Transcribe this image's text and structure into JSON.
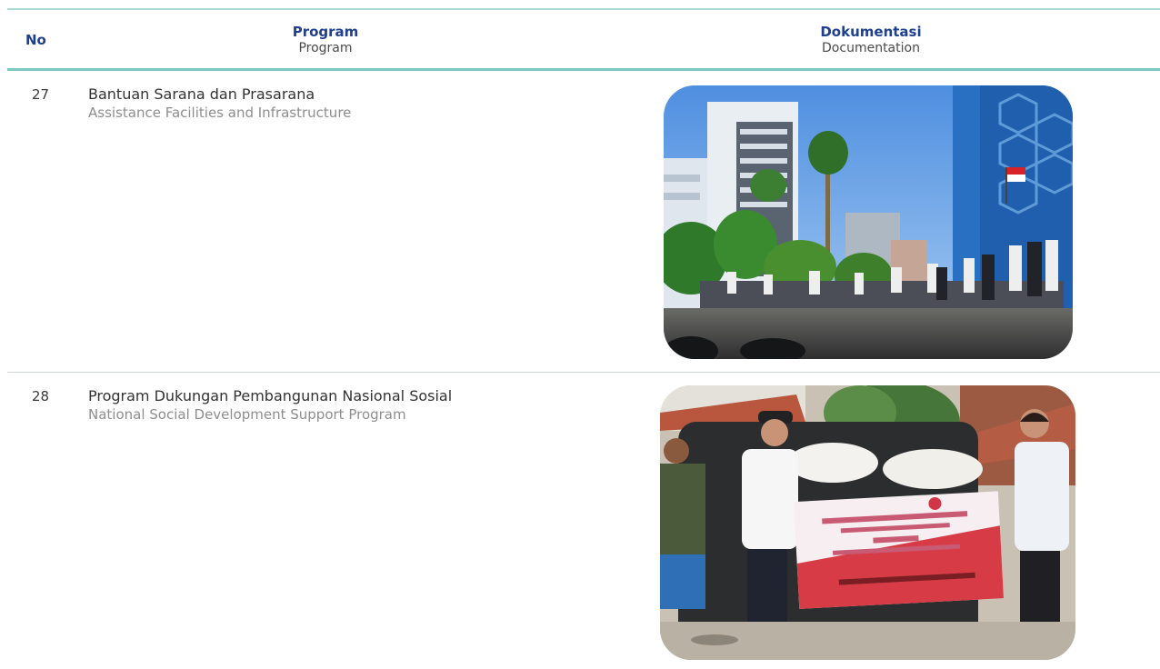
{
  "table": {
    "headers": {
      "no": "No",
      "program_title": "Program",
      "program_sub": "Program",
      "doc_title": "Dokumentasi",
      "doc_sub": "Documentation"
    },
    "rows": [
      {
        "no": "27",
        "title": "Bantuan Sarana dan Prasarana",
        "subtitle": "Assistance Facilities and Infrastructure",
        "photo_icon": "photo-buildings-crowd"
      },
      {
        "no": "28",
        "title": "Program Dukungan Pembangunan Nasional Sosial",
        "subtitle": "National Social Development Support Program",
        "photo_icon": "photo-handover-banner"
      }
    ]
  },
  "colors": {
    "header_text": "#1f3f8f",
    "rule_accent": "#7cc8c2"
  }
}
